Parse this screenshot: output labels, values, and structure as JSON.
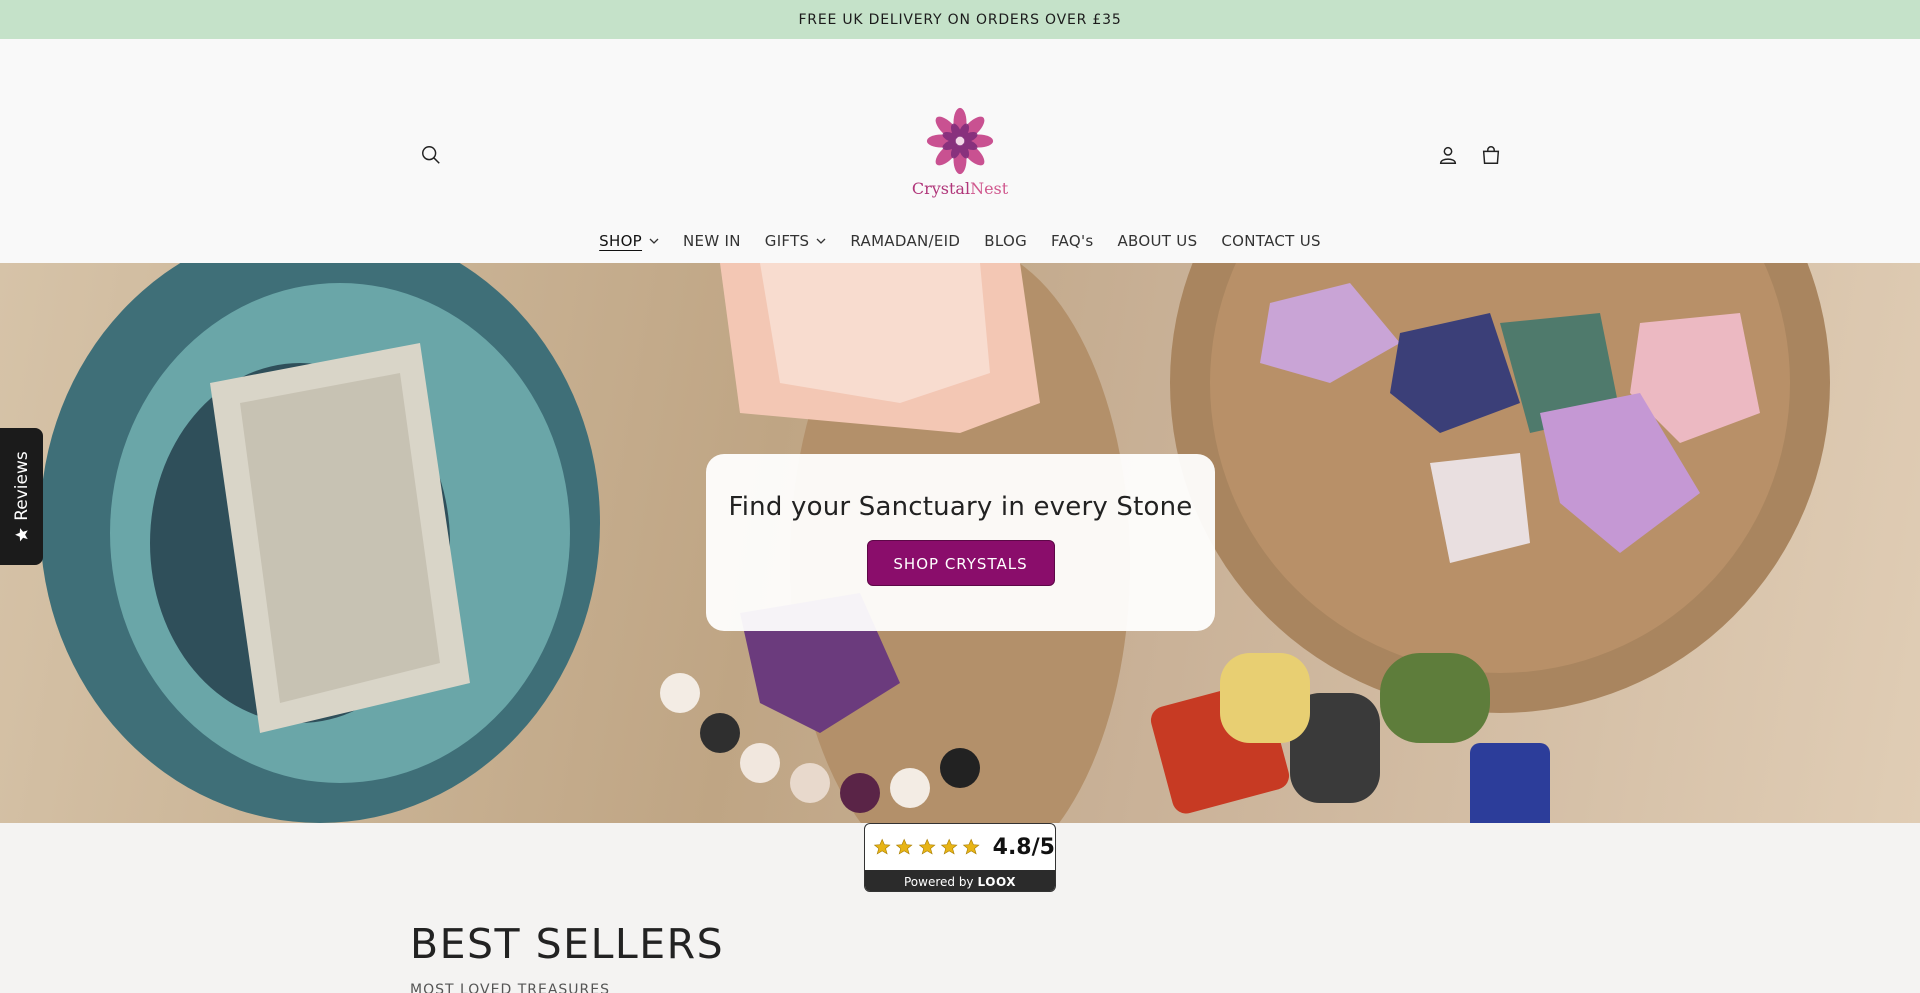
{
  "announcement": {
    "text": "FREE UK DELIVERY ON ORDERS OVER £35"
  },
  "header": {
    "logo": {
      "name": "Crystal",
      "name_accent": "Nest"
    },
    "icons": {
      "search": "search-icon",
      "account": "user-icon",
      "cart": "cart-icon"
    }
  },
  "nav": {
    "items": [
      {
        "label": "SHOP",
        "dropdown": true,
        "active": true
      },
      {
        "label": "NEW IN",
        "dropdown": false
      },
      {
        "label": "GIFTS",
        "dropdown": true
      },
      {
        "label": "RAMADAN/EID",
        "dropdown": false
      },
      {
        "label": "BLOG",
        "dropdown": false
      },
      {
        "label": "FAQ's",
        "dropdown": false
      },
      {
        "label": "ABOUT US",
        "dropdown": false
      },
      {
        "label": "CONTACT US",
        "dropdown": false
      }
    ]
  },
  "hero": {
    "heading": "Find your Sanctuary in every Stone",
    "button_label": "SHOP CRYSTALS"
  },
  "reviews_tab": {
    "label": "Reviews"
  },
  "rating_badge": {
    "value": "4.8/5",
    "stars": 5,
    "powered_by": "Powered by",
    "brand": "LOOX"
  },
  "best_sellers": {
    "title": "BEST SELLERS",
    "subtitle": "MOST LOVED TREASURES"
  },
  "colors": {
    "announcement_bg": "#c5e2c9",
    "accent": "#8a0d6b",
    "star": "#e7b416"
  }
}
